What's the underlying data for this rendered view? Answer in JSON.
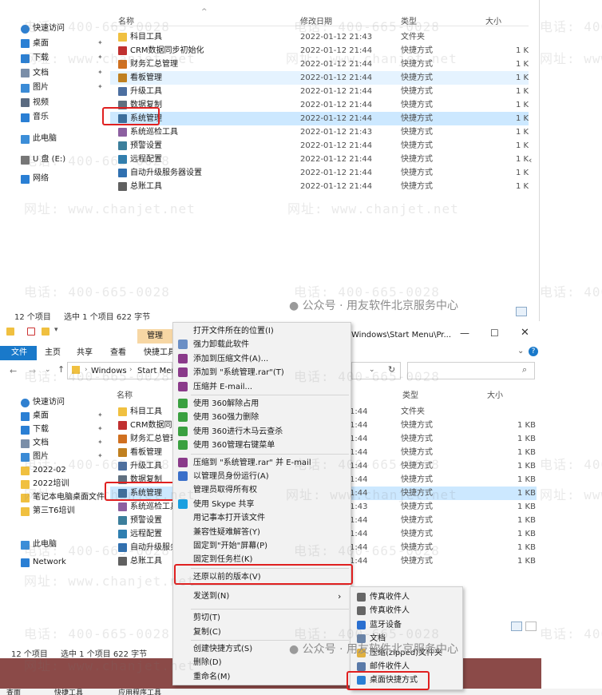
{
  "top": {
    "columns": {
      "name": "名称",
      "date": "修改日期",
      "type": "类型",
      "size": "大小"
    },
    "nav": [
      {
        "label": "快速访问",
        "icon": "star-icon",
        "pin": false
      },
      {
        "label": "桌面",
        "icon": "desktop-icon",
        "pin": true
      },
      {
        "label": "下载",
        "icon": "download-icon",
        "pin": true
      },
      {
        "label": "文档",
        "icon": "document-icon",
        "pin": true
      },
      {
        "label": "图片",
        "icon": "picture-icon",
        "pin": true
      },
      {
        "label": "视频",
        "icon": "video-icon",
        "pin": false
      },
      {
        "label": "音乐",
        "icon": "music-icon",
        "pin": false
      },
      {
        "label": "此电脑",
        "icon": "computer-icon",
        "pin": false
      },
      {
        "label": "U 盘 (E:)",
        "icon": "usb-drive-icon",
        "pin": false
      },
      {
        "label": "网络",
        "icon": "network-icon",
        "pin": false
      }
    ],
    "rows": [
      {
        "name": "科目工具",
        "date": "2022-01-12 21:43",
        "type": "文件夹",
        "size": ""
      },
      {
        "name": "CRM数据同步初始化",
        "date": "2022-01-12 21:44",
        "type": "快捷方式",
        "size": "1 K"
      },
      {
        "name": "财务汇总管理",
        "date": "2022-01-12 21:44",
        "type": "快捷方式",
        "size": "1 K"
      },
      {
        "name": "看板管理",
        "date": "2022-01-12 21:44",
        "type": "快捷方式",
        "size": "1 K"
      },
      {
        "name": "升级工具",
        "date": "2022-01-12 21:44",
        "type": "快捷方式",
        "size": "1 K"
      },
      {
        "name": "数据复制",
        "date": "2022-01-12 21:44",
        "type": "快捷方式",
        "size": "1 K"
      },
      {
        "name": "系统管理",
        "date": "2022-01-12 21:44",
        "type": "快捷方式",
        "size": "1 K"
      },
      {
        "name": "系统巡检工具",
        "date": "2022-01-12 21:43",
        "type": "快捷方式",
        "size": "1 K"
      },
      {
        "name": "预警设置",
        "date": "2022-01-12 21:44",
        "type": "快捷方式",
        "size": "1 K"
      },
      {
        "name": "远程配置",
        "date": "2022-01-12 21:44",
        "type": "快捷方式",
        "size": "1 K"
      },
      {
        "name": "自动升级服务器设置",
        "date": "2022-01-12 21:44",
        "type": "快捷方式",
        "size": "1 K"
      },
      {
        "name": "总账工具",
        "date": "2022-01-12 21:44",
        "type": "快捷方式",
        "size": "1 K"
      }
    ],
    "status_count": "12 个项目",
    "status_selected": "选中 1 个项目  622 字节"
  },
  "bottom": {
    "tabs": {
      "file": "文件",
      "home": "主页",
      "share": "共享",
      "view": "查看",
      "tools": "快捷工具",
      "manage": "管理"
    },
    "address": {
      "path1": "Windows",
      "path2": "Start Men",
      "title_path": "Windows\\Start Menu\\Pr..."
    },
    "columns": {
      "name": "名称",
      "type": "类型",
      "size": "大小"
    },
    "nav": [
      {
        "label": "快速访问",
        "icon": "star-icon",
        "pin": false
      },
      {
        "label": "桌面",
        "icon": "desktop-icon",
        "pin": true
      },
      {
        "label": "下载",
        "icon": "download-icon",
        "pin": true
      },
      {
        "label": "文档",
        "icon": "document-icon",
        "pin": true
      },
      {
        "label": "图片",
        "icon": "picture-icon",
        "pin": true
      },
      {
        "label": "2022-02",
        "icon": "folder-icon",
        "pin": false
      },
      {
        "label": "2022培训",
        "icon": "folder-icon",
        "pin": false
      },
      {
        "label": "笔记本电脑桌面文件",
        "icon": "folder-icon",
        "pin": false
      },
      {
        "label": "第三T6培训",
        "icon": "folder-icon",
        "pin": false
      },
      {
        "label": "此电脑",
        "icon": "computer-icon",
        "pin": false
      },
      {
        "label": "Network",
        "icon": "network-icon",
        "pin": false
      }
    ],
    "rows": [
      {
        "name": "科目工具",
        "date": "1:44",
        "type": "文件夹",
        "size": ""
      },
      {
        "name": "CRM数据同步",
        "date": "1:44",
        "type": "快捷方式",
        "size": "1 KB"
      },
      {
        "name": "财务汇总管理",
        "date": "1:44",
        "type": "快捷方式",
        "size": "1 KB"
      },
      {
        "name": "看板管理",
        "date": "1:44",
        "type": "快捷方式",
        "size": "1 KB"
      },
      {
        "name": "升级工具",
        "date": "1:44",
        "type": "快捷方式",
        "size": "1 KB"
      },
      {
        "name": "数据复制",
        "date": "1:44",
        "type": "快捷方式",
        "size": "1 KB"
      },
      {
        "name": "系统管理",
        "date": "1:44",
        "type": "快捷方式",
        "size": "1 KB"
      },
      {
        "name": "系统巡检工具",
        "date": "1:43",
        "type": "快捷方式",
        "size": "1 KB"
      },
      {
        "name": "预警设置",
        "date": "1:44",
        "type": "快捷方式",
        "size": "1 KB"
      },
      {
        "name": "远程配置",
        "date": "1:44",
        "type": "快捷方式",
        "size": "1 KB"
      },
      {
        "name": "自动升级服务",
        "date": "1:44",
        "type": "快捷方式",
        "size": "1 KB"
      },
      {
        "name": "总账工具",
        "date": "1:44",
        "type": "快捷方式",
        "size": "1 KB"
      }
    ],
    "status_count": "12 个项目",
    "status_selected": "选中 1 个项目  622 字节",
    "taskbar": [
      "查面",
      "快捷工具",
      "应用程序工具"
    ]
  },
  "context_menu": [
    {
      "label": "打开文件所在的位置(I)",
      "icon": ""
    },
    {
      "label": "强力卸载此软件",
      "icon": "uninstall-icon"
    },
    {
      "label": "添加到压缩文件(A)...",
      "icon": "winrar-icon"
    },
    {
      "label": "添加到 \"系统管理.rar\"(T)",
      "icon": "winrar-icon"
    },
    {
      "label": "压缩并 E-mail...",
      "icon": "winrar-icon"
    },
    {
      "label": "使用 360解除占用",
      "icon": "360-icon"
    },
    {
      "label": "使用 360强力删除",
      "icon": "360-icon"
    },
    {
      "label": "使用 360进行木马云查杀",
      "icon": "360-icon"
    },
    {
      "label": "使用 360管理右键菜单",
      "icon": "360-icon"
    },
    {
      "label": "压缩到 \"系统管理.rar\" 并 E-mail",
      "icon": "winrar-icon"
    },
    {
      "label": "以管理员身份运行(A)",
      "icon": "shield-icon"
    },
    {
      "label": "管理员取得所有权",
      "icon": ""
    },
    {
      "label": "使用 Skype 共享",
      "icon": "skype-icon"
    },
    {
      "label": "用记事本打开该文件",
      "icon": ""
    },
    {
      "label": "兼容性疑难解答(Y)",
      "icon": ""
    },
    {
      "label": "固定到\"开始\"屏幕(P)",
      "icon": ""
    },
    {
      "label": "固定到任务栏(K)",
      "icon": ""
    },
    {
      "label": "还原以前的版本(V)",
      "icon": ""
    },
    {
      "label": "发送到(N)",
      "icon": ""
    },
    {
      "label": "剪切(T)",
      "icon": ""
    },
    {
      "label": "复制(C)",
      "icon": ""
    },
    {
      "label": "创建快捷方式(S)",
      "icon": ""
    },
    {
      "label": "删除(D)",
      "icon": ""
    },
    {
      "label": "重命名(M)",
      "icon": ""
    }
  ],
  "submenu": [
    {
      "label": "传真收件人",
      "icon": "fax-icon"
    },
    {
      "label": "传真收件人",
      "icon": "fax-icon"
    },
    {
      "label": "蓝牙设备",
      "icon": "bluetooth-icon"
    },
    {
      "label": "文档",
      "icon": "document-icon"
    },
    {
      "label": "压缩(zipped)文件夹",
      "icon": "zip-folder-icon"
    },
    {
      "label": "邮件收件人",
      "icon": "mail-icon"
    },
    {
      "label": "桌面快捷方式",
      "icon": "desktop-icon"
    }
  ],
  "watermark": {
    "phone": "电话: 400-665-0028",
    "site": "网址: www.chanjet.net"
  },
  "wechat": "公众号 · 用友软件北京服务中心",
  "colors": {
    "selection": "#cce8ff",
    "highlight_box": "#e02020",
    "ribbon_file": "#1979ca",
    "manage_tab": "#f7d7a4"
  }
}
